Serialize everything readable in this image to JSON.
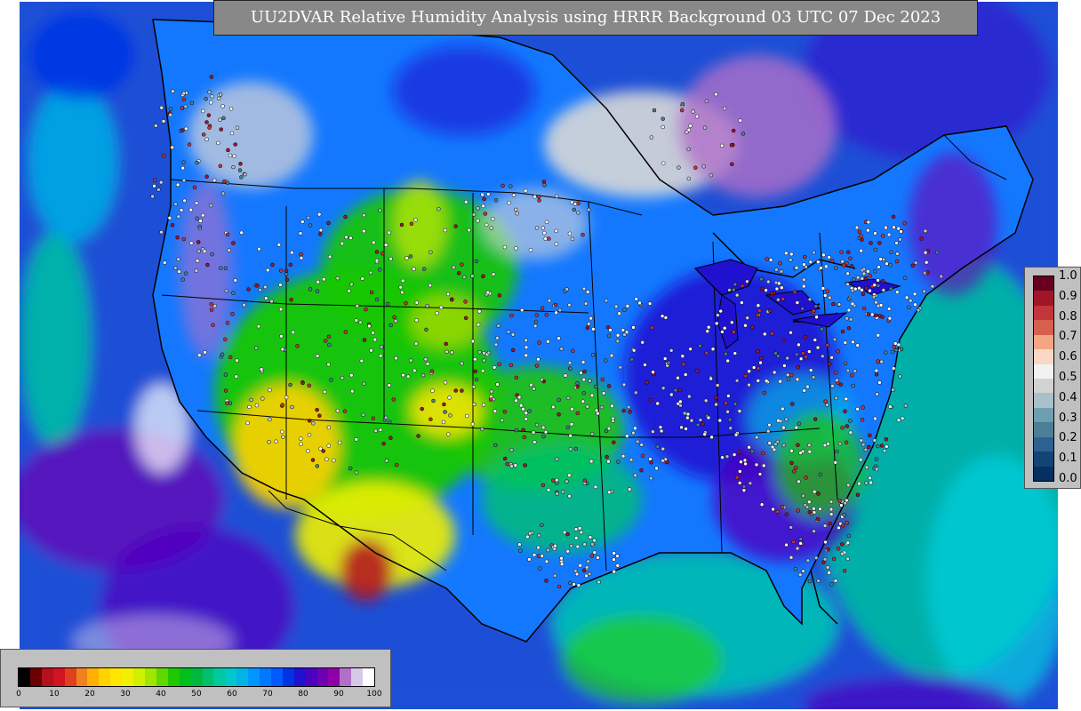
{
  "title": "UU2DVAR Relative Humidity Analysis using HRRR Background 03 UTC 07 Dec 2023",
  "colors": {
    "ocean": "#1a4fd6",
    "land_dry": "#ffd200",
    "land_mid": "#14c800",
    "land_humid": "#1478ff",
    "land_very_humid": "#8a00c8",
    "saturated": "#d8d8d8",
    "border_lines": "#000000",
    "title_bg": "#888888"
  },
  "station_legend": {
    "labels": [
      "1.0",
      "0.9",
      "0.8",
      "0.7",
      "0.6",
      "0.5",
      "0.4",
      "0.3",
      "0.2",
      "0.1",
      "0.0"
    ],
    "colors": [
      "#67001f",
      "#a01528",
      "#c2353b",
      "#d6604d",
      "#f4a582",
      "#fbd8c5",
      "#f2f2f2",
      "#d2d2d2",
      "#a9bfc9",
      "#6e9fb0",
      "#4d7e98",
      "#2b6291",
      "#134476",
      "#053061"
    ]
  },
  "rh_legend": {
    "ticks": [
      "0",
      "10",
      "20",
      "30",
      "40",
      "50",
      "60",
      "70",
      "80",
      "90",
      "100"
    ],
    "colors": [
      "#000000",
      "#6b0000",
      "#b4101e",
      "#d01420",
      "#e04020",
      "#f08020",
      "#ffb000",
      "#ffd200",
      "#ffe600",
      "#f0f000",
      "#d0f000",
      "#a0e600",
      "#60d800",
      "#20c800",
      "#00c020",
      "#00b840",
      "#00c070",
      "#00c8a0",
      "#00c8c8",
      "#00b4e6",
      "#0096ff",
      "#0078ff",
      "#005aff",
      "#0032e6",
      "#2010d0",
      "#4c00c0",
      "#6e00b4",
      "#9000a8",
      "#b070c8",
      "#d8c8e8",
      "#ffffff"
    ]
  }
}
